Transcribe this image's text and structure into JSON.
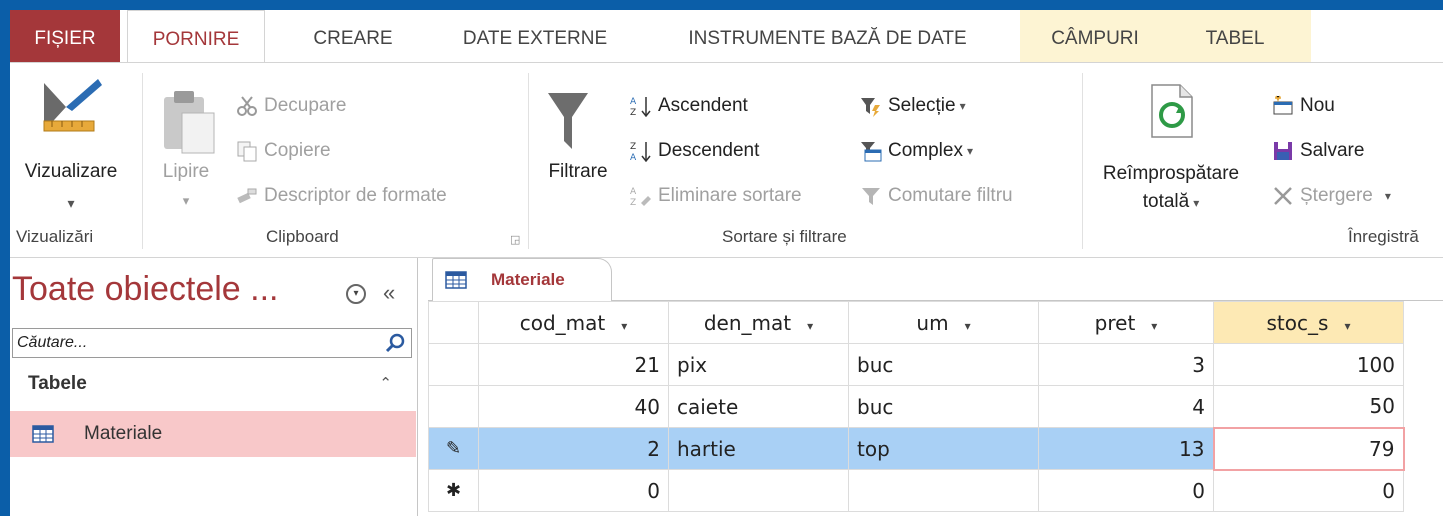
{
  "ribbon_tabs": {
    "file": "FIȘIER",
    "home": "PORNIRE",
    "create": "CREARE",
    "external": "DATE EXTERNE",
    "tools": "INSTRUMENTE BAZĂ DE DATE",
    "fields": "CÂMPURI",
    "table": "TABEL"
  },
  "groups": {
    "views": {
      "label": "Vizualizări",
      "view_btn": "Vizualizare",
      "view_caret": "▾"
    },
    "clipboard": {
      "label": "Clipboard",
      "paste": "Lipire",
      "paste_caret": "▾",
      "cut": "Decupare",
      "copy": "Copiere",
      "format_painter": "Descriptor de formate"
    },
    "sort_filter": {
      "label": "Sortare și filtrare",
      "filter": "Filtrare",
      "ascending": "Ascendent",
      "descending": "Descendent",
      "remove_sort": "Eliminare sortare",
      "selection": "Selecție",
      "advanced": "Complex",
      "toggle_filter": "Comutare filtru"
    },
    "records": {
      "label": "Înregistră",
      "refresh_line1": "Reîmprospătare",
      "refresh_line2": "totală",
      "new": "Nou",
      "save": "Salvare",
      "delete": "Ștergere"
    }
  },
  "nav": {
    "title": "Toate obiectele ...",
    "collapse": "«",
    "search_placeholder": "Căutare...",
    "group": "Tabele",
    "group_chevron": "⌃",
    "items": [
      {
        "label": "Materiale"
      }
    ]
  },
  "document": {
    "tab_label": "Materiale",
    "columns": [
      "cod_mat",
      "den_mat",
      "um",
      "pret",
      "stoc_s"
    ],
    "dropdown_glyph": "▾",
    "rows": [
      {
        "selector": "",
        "cod_mat": "21",
        "den_mat": "pix",
        "um": "buc",
        "pret": "3",
        "stoc_s": "100"
      },
      {
        "selector": "",
        "cod_mat": "40",
        "den_mat": "caiete",
        "um": "buc",
        "pret": "4",
        "stoc_s": "50"
      },
      {
        "selector": "✎",
        "cod_mat": "2",
        "den_mat": "hartie",
        "um": "top",
        "pret": "13",
        "stoc_s": "79"
      },
      {
        "selector": "✱",
        "cod_mat": "0",
        "den_mat": "",
        "um": "",
        "pret": "0",
        "stoc_s": "0"
      }
    ]
  },
  "colors": {
    "accent": "#a4373a",
    "window_bg": "#0b5ea8",
    "selected_row": "#a9d0f5",
    "nav_selected": "#f8c8c9",
    "context_tab_bg": "#fdf4d3"
  }
}
